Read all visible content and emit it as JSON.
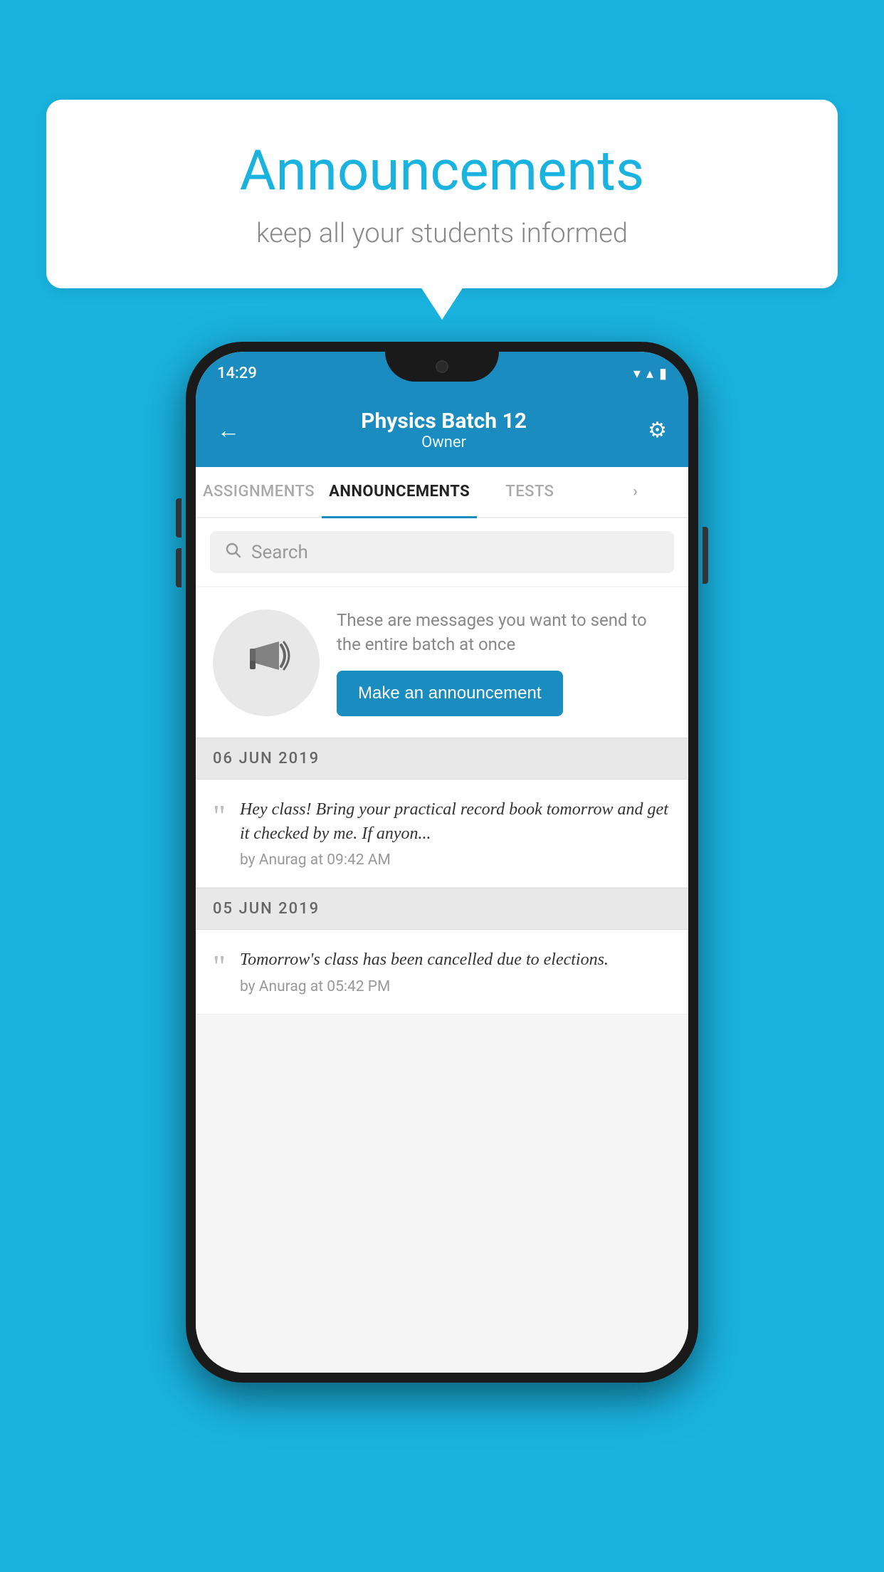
{
  "background_color": "#1ab3e0",
  "speech_bubble": {
    "title": "Announcements",
    "subtitle": "keep all your students informed"
  },
  "status_bar": {
    "time": "14:29",
    "wifi_icon": "▼",
    "signal_icon": "▲",
    "battery_icon": "▮"
  },
  "header": {
    "back_label": "←",
    "title": "Physics Batch 12",
    "subtitle": "Owner",
    "settings_label": "⚙"
  },
  "tabs": [
    {
      "label": "ASSIGNMENTS",
      "active": false
    },
    {
      "label": "ANNOUNCEMENTS",
      "active": true
    },
    {
      "label": "TESTS",
      "active": false
    },
    {
      "label": "›",
      "active": false
    }
  ],
  "search": {
    "placeholder": "Search"
  },
  "promo": {
    "description": "These are messages you want to send to the entire batch at once",
    "button_label": "Make an announcement"
  },
  "announcements": [
    {
      "date": "06  JUN  2019",
      "message": "Hey class! Bring your practical record book tomorrow and get it checked by me. If anyon...",
      "meta": "by Anurag at 09:42 AM"
    },
    {
      "date": "05  JUN  2019",
      "message": "Tomorrow's class has been cancelled due to elections.",
      "meta": "by Anurag at 05:42 PM"
    }
  ]
}
